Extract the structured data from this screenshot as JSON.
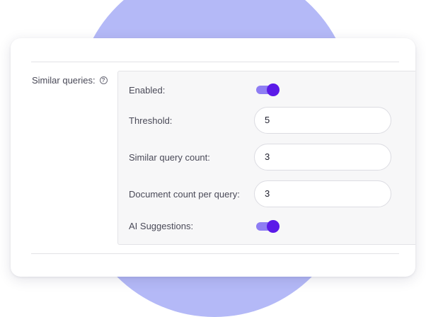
{
  "settings": {
    "section_label": "Similar queries:",
    "help_icon": "help-circle-icon",
    "rows": {
      "enabled": {
        "label": "Enabled:",
        "value": true
      },
      "threshold": {
        "label": "Threshold:",
        "value": "5"
      },
      "similar_query_count": {
        "label": "Similar query count:",
        "value": "3"
      },
      "document_count_per_query": {
        "label": "Document count per query:",
        "value": "3"
      },
      "ai_suggestions": {
        "label": "AI Suggestions:",
        "value": true
      }
    }
  },
  "colors": {
    "accent": "#5b1ae8",
    "toggle_track": "#8e7df3",
    "background_circle": "#b4b9f7"
  }
}
